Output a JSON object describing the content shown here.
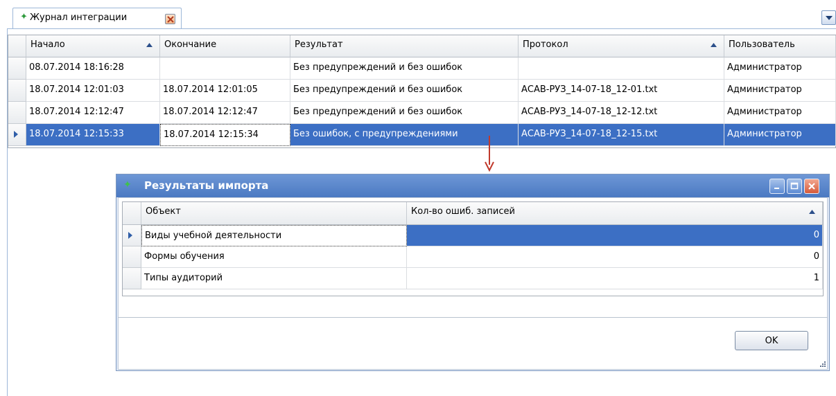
{
  "tab": {
    "title": "Журнал интеграции",
    "icon": "green-diamond-icon"
  },
  "main_grid": {
    "columns": [
      "Начало",
      "Окончание",
      "Результат",
      "Протокол",
      "Пользователь"
    ],
    "sorted_columns": [
      "Начало",
      "Протокол"
    ],
    "rows": [
      [
        "08.07.2014 18:16:28",
        "",
        "Без предупреждений и без ошибок",
        "",
        "Администратор"
      ],
      [
        "18.07.2014 12:01:03",
        "18.07.2014 12:01:05",
        "Без предупреждений и без ошибок",
        "АСАВ-РУЗ_14-07-18_12-01.txt",
        "Администратор"
      ],
      [
        "18.07.2014 12:12:47",
        "18.07.2014 12:12:47",
        "Без предупреждений и без ошибок",
        "АСАВ-РУЗ_14-07-18_12-12.txt",
        "Администратор"
      ],
      [
        "18.07.2014 12:15:33",
        "18.07.2014 12:15:34",
        "Без ошибок, с предупреждениями",
        "АСАВ-РУЗ_14-07-18_12-15.txt",
        "Администратор"
      ]
    ],
    "selected_row": 3
  },
  "dialog": {
    "title": "Результаты импорта",
    "columns": [
      "Объект",
      "Кол-во ошиб. записей"
    ],
    "rows": [
      [
        "Виды учебной деятельности",
        "0"
      ],
      [
        "Формы обучения",
        "0"
      ],
      [
        "Типы аудиторий",
        "1"
      ]
    ],
    "selected_row": 0,
    "ok_label": "OK"
  },
  "colors": {
    "selection": "#3c6fc4",
    "title_bar": "#4a79c2",
    "annotation_arrow": "#c0392b"
  }
}
